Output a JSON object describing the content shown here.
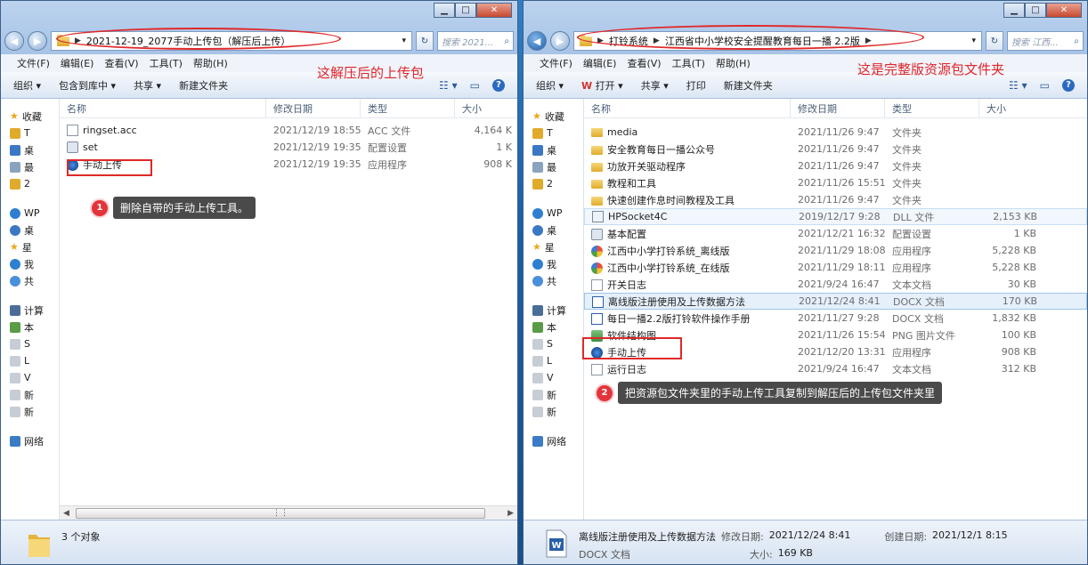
{
  "left": {
    "path": [
      "2021-12-19_2077手动上传包（解压后上传）"
    ],
    "search_placeholder": "搜索 2021...",
    "menu": [
      "文件(F)",
      "编辑(E)",
      "查看(V)",
      "工具(T)",
      "帮助(H)"
    ],
    "toolbar": [
      "组织 ▾",
      "包含到库中 ▾",
      "共享 ▾",
      "新建文件夹"
    ],
    "annotation_label": "这解压后的上传包",
    "nav": [
      "收藏",
      "T",
      "桌",
      "最",
      "2",
      "",
      "WP",
      "桌",
      "星",
      "我",
      "共",
      "",
      "计算",
      "本",
      "S",
      "L",
      "V",
      "新",
      "新",
      "",
      "网络"
    ],
    "columns": [
      "名称",
      "修改日期",
      "类型",
      "大小"
    ],
    "rows": [
      {
        "icon": "doc",
        "name": "ringset.acc",
        "date": "2021/12/19 18:55",
        "type": "ACC 文件",
        "size": "4,164 K"
      },
      {
        "icon": "cfg",
        "name": "set",
        "date": "2021/12/19 19:35",
        "type": "配置设置",
        "size": "1 K"
      },
      {
        "icon": "app",
        "name": "手动上传",
        "date": "2021/12/19 19:35",
        "type": "应用程序",
        "size": "908 K"
      }
    ],
    "callout": {
      "num": "1",
      "text": "删除自带的手动上传工具。"
    },
    "status": "3 个对象"
  },
  "right": {
    "path": [
      "打铃系统",
      "江西省中小学校安全提醒教育每日一播 2.2版"
    ],
    "search_placeholder": "搜索 江西...",
    "menu": [
      "文件(F)",
      "编辑(E)",
      "查看(V)",
      "工具(T)",
      "帮助(H)"
    ],
    "toolbar": [
      "组织 ▾",
      "打开 ▾",
      "共享 ▾",
      "打印",
      "新建文件夹"
    ],
    "annotation_label": "这是完整版资源包文件夹",
    "nav": [
      "收藏",
      "T",
      "桌",
      "最",
      "2",
      "",
      "WP",
      "桌",
      "星",
      "我",
      "共",
      "",
      "计算",
      "本",
      "S",
      "L",
      "V",
      "新",
      "新",
      "",
      "网络"
    ],
    "columns": [
      "名称",
      "修改日期",
      "类型",
      "大小"
    ],
    "rows": [
      {
        "icon": "folder",
        "name": "media",
        "date": "2021/11/26 9:47",
        "type": "文件夹",
        "size": ""
      },
      {
        "icon": "folder",
        "name": "安全教育每日一播公众号",
        "date": "2021/11/26 9:47",
        "type": "文件夹",
        "size": ""
      },
      {
        "icon": "folder",
        "name": "功放开关驱动程序",
        "date": "2021/11/26 9:47",
        "type": "文件夹",
        "size": ""
      },
      {
        "icon": "folder",
        "name": "教程和工具",
        "date": "2021/11/26 15:51",
        "type": "文件夹",
        "size": ""
      },
      {
        "icon": "folder",
        "name": "快速创建作息时间教程及工具",
        "date": "2021/11/26 9:47",
        "type": "文件夹",
        "size": ""
      },
      {
        "icon": "dll",
        "name": "HPSocket4C",
        "date": "2019/12/17 9:28",
        "type": "DLL 文件",
        "size": "2,153 KB"
      },
      {
        "icon": "cfg",
        "name": "基本配置",
        "date": "2021/12/21 16:32",
        "type": "配置设置",
        "size": "1 KB"
      },
      {
        "icon": "app2",
        "name": "江西中小学打铃系统_离线版",
        "date": "2021/11/29 18:08",
        "type": "应用程序",
        "size": "5,228 KB"
      },
      {
        "icon": "app2",
        "name": "江西中小学打铃系统_在线版",
        "date": "2021/11/29 18:11",
        "type": "应用程序",
        "size": "5,228 KB"
      },
      {
        "icon": "doc",
        "name": "开关日志",
        "date": "2021/9/24 16:47",
        "type": "文本文档",
        "size": "30 KB"
      },
      {
        "icon": "word",
        "name": "离线版注册使用及上传数据方法",
        "date": "2021/12/24 8:41",
        "type": "DOCX 文档",
        "size": "170 KB"
      },
      {
        "icon": "word",
        "name": "每日一播2.2版打铃软件操作手册",
        "date": "2021/11/27 9:28",
        "type": "DOCX 文档",
        "size": "1,832 KB"
      },
      {
        "icon": "png",
        "name": "软件结构图",
        "date": "2021/11/26 15:54",
        "type": "PNG 图片文件",
        "size": "100 KB"
      },
      {
        "icon": "app",
        "name": "手动上传",
        "date": "2021/12/20 13:31",
        "type": "应用程序",
        "size": "908 KB"
      },
      {
        "icon": "doc",
        "name": "运行日志",
        "date": "2021/9/24 16:47",
        "type": "文本文档",
        "size": "312 KB"
      }
    ],
    "callout": {
      "num": "2",
      "text": "把资源包文件夹里的手动上传工具复制到解压后的上传包文件夹里"
    },
    "status": {
      "name": "离线版注册使用及上传数据方法",
      "modified_label": "修改日期:",
      "modified": "2021/12/24 8:41",
      "created_label": "创建日期:",
      "created": "2021/12/1 8:15",
      "type": "DOCX 文档",
      "size_label": "大小:",
      "size": "169 KB"
    }
  }
}
